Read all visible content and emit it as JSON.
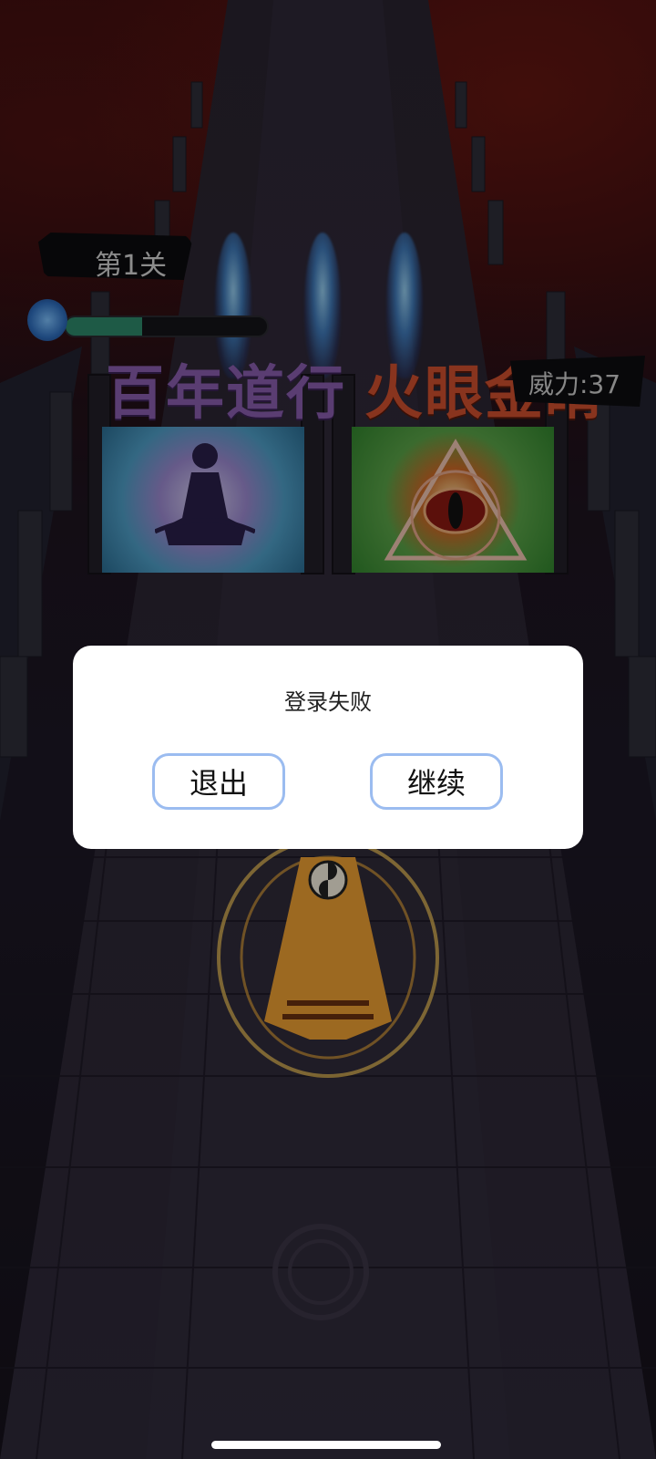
{
  "hud": {
    "level_label": "第1关",
    "power_label": "威力:37",
    "power_fraction": 0.38
  },
  "gates": {
    "left_title": "百年道行",
    "right_title": "火眼金睛",
    "left_icon": "meditating-figure-icon",
    "right_icon": "eye-triangle-icon"
  },
  "dialog": {
    "title": "登录失败",
    "exit_label": "退出",
    "continue_label": "继续"
  },
  "colors": {
    "bar_fill": "#2f8a6c",
    "button_border": "#9bbcf0",
    "left_title_color": "#8a5fb0",
    "right_title_color": "#d2502f"
  }
}
